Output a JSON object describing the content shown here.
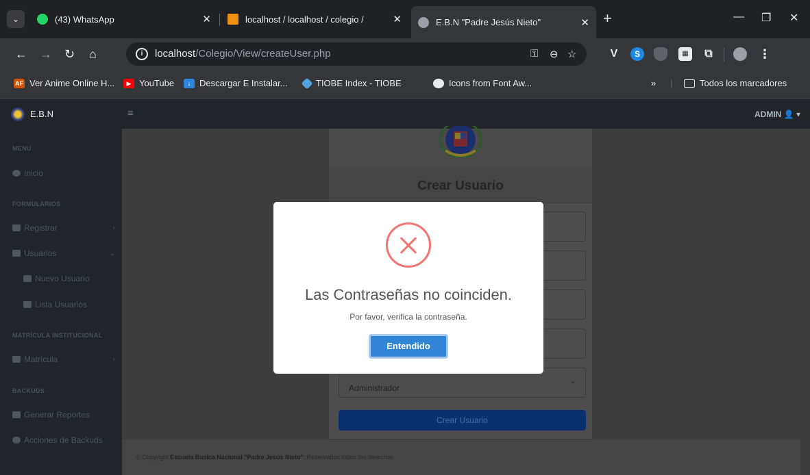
{
  "browser": {
    "tabs": [
      {
        "title": "(43) WhatsApp",
        "icon": "whatsapp-icon",
        "active": false
      },
      {
        "title": "localhost / localhost / colegio /",
        "icon": "phpmyadmin-icon",
        "active": false
      },
      {
        "title": "E.B.N \"Padre Jesús Nieto\"",
        "icon": "globe-icon",
        "active": true
      }
    ],
    "url_host": "localhost",
    "url_path": "/Colegio/View/createUser.php",
    "bookmarks": [
      {
        "label": "Ver Anime Online H...",
        "icon": "animeflv-icon"
      },
      {
        "label": "YouTube",
        "icon": "youtube-icon"
      },
      {
        "label": "Descargar E Instalar...",
        "icon": "download-icon"
      },
      {
        "label": "TIOBE Index - TIOBE",
        "icon": "tiobe-icon"
      },
      {
        "label": "Icons from Font Aw...",
        "icon": "globe-icon"
      }
    ],
    "all_bookmarks": "Todos los marcadores"
  },
  "app": {
    "brand": "E.B.N",
    "user": "ADMIN",
    "sidebar": {
      "sections": [
        {
          "heading": "MENU"
        },
        {
          "heading": "FORMULARIOS"
        },
        {
          "heading": "MATRÍCULA INSTITUCIONAL"
        },
        {
          "heading": "BACKUDS"
        }
      ],
      "items": {
        "inicio": "Inicio",
        "registrar": "Registrar",
        "usuarios": "Usuarios",
        "nuevo_usuario": "Nuevo Usuario",
        "lista_usuarios": "Lista Usuarios",
        "matricula": "Matrícula",
        "generar_reportes": "Generar Reportes",
        "acciones_backuds": "Acciones de Backuds"
      }
    },
    "form": {
      "title": "Crear Usuario",
      "role_value": "Administrador",
      "submit_label": "Crear Usuario"
    },
    "footer": {
      "prefix": "© Copyright",
      "school": "Escuela Basica Nacional \"Padre Jesús Nieto\"",
      "suffix": ". Reservados todos los derechos"
    }
  },
  "modal": {
    "title": "Las Contraseñas no coinciden.",
    "text": "Por favor, verifica la contraseña.",
    "button": "Entendido",
    "icon": "error-x-icon"
  },
  "colors": {
    "modal_button": "#3085d6",
    "error_icon": "#f27474"
  }
}
